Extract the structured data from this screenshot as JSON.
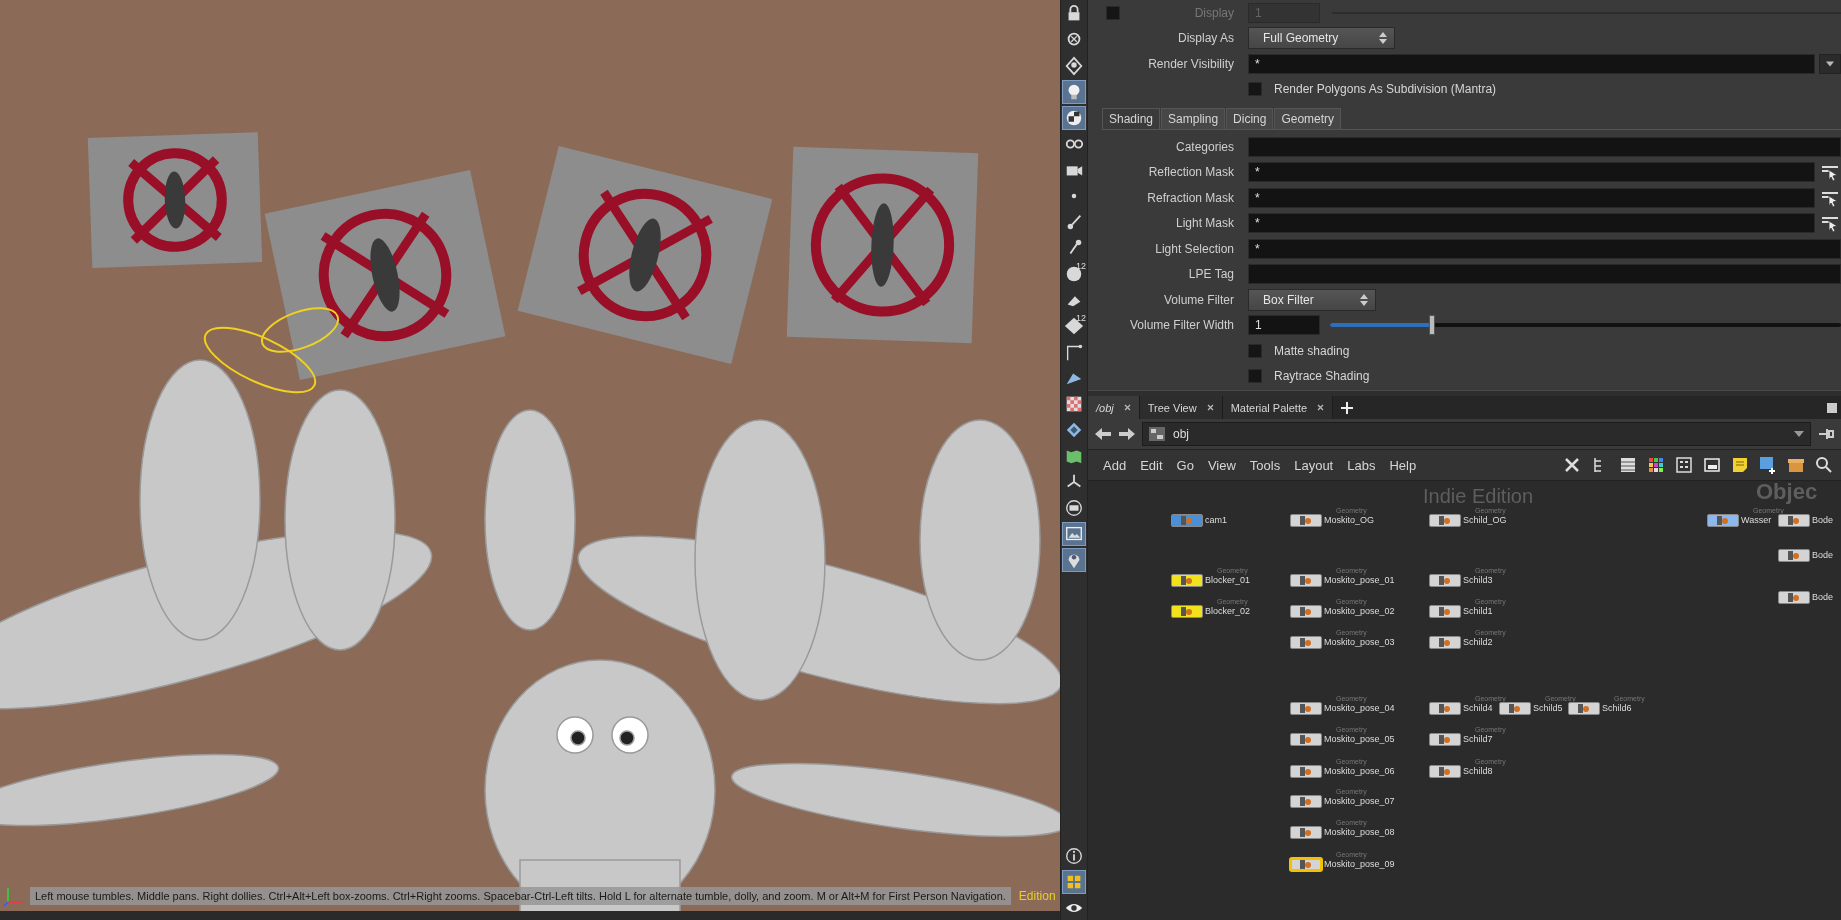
{
  "viewport": {
    "status_text": "Left mouse tumbles. Middle pans. Right dollies. Ctrl+Alt+Left box-zooms. Ctrl+Right zooms. Spacebar-Ctrl-Left tilts. Hold L for alternate tumble, dolly, and zoom. M or Alt+M for First Person Navigation.",
    "edition_text": "Edition"
  },
  "shelf_top": [
    {
      "kind": "lock",
      "selected": false
    },
    {
      "kind": "ghost",
      "selected": false
    },
    {
      "kind": "light_diamond",
      "selected": false
    },
    {
      "kind": "bulb",
      "selected": true
    },
    {
      "kind": "sphere",
      "selected": true
    },
    {
      "kind": "glasses",
      "selected": false
    },
    {
      "kind": "camera",
      "selected": false
    },
    {
      "kind": "dot",
      "selected": false
    },
    {
      "kind": "brush",
      "selected": false
    },
    {
      "kind": "pin",
      "selected": false
    },
    {
      "kind": "dot_number",
      "label": "12",
      "selected": false
    },
    {
      "kind": "paint",
      "selected": false
    },
    {
      "kind": "layers_number",
      "label": "12",
      "selected": false
    },
    {
      "kind": "corner",
      "selected": false
    },
    {
      "kind": "plane",
      "selected": false
    },
    {
      "kind": "checker",
      "selected": false
    },
    {
      "kind": "diamond",
      "selected": false
    },
    {
      "kind": "map",
      "selected": false
    },
    {
      "kind": "axes",
      "selected": false
    },
    {
      "kind": "frame",
      "selected": false
    },
    {
      "kind": "picture",
      "selected": true
    },
    {
      "kind": "location",
      "selected": true
    }
  ],
  "shelf_bottom": [
    {
      "kind": "info",
      "selected": false
    },
    {
      "kind": "grid",
      "selected": true
    },
    {
      "kind": "eye",
      "selected": false
    }
  ],
  "parameters": [
    {
      "kind": "toggle_field",
      "label": "Display",
      "value": "1",
      "checked": false,
      "disabled": true
    },
    {
      "kind": "dropdown",
      "label": "Display As",
      "value": "Full Geometry"
    },
    {
      "kind": "field",
      "label": "Render Visibility",
      "value": "*",
      "menu": true
    },
    {
      "kind": "checkbox",
      "label": "Render Polygons As Subdivision (Mantra)",
      "checked": false
    }
  ],
  "parameter_tabs": [
    {
      "label": "Shading",
      "selected": true
    },
    {
      "label": "Sampling",
      "selected": false
    },
    {
      "label": "Dicing",
      "selected": false
    },
    {
      "label": "Geometry",
      "selected": false
    }
  ],
  "shading_parameters": [
    {
      "kind": "field",
      "label": "Categories"
    },
    {
      "kind": "field",
      "label": "Reflection Mask",
      "value": "*",
      "picker": true
    },
    {
      "kind": "field",
      "label": "Refraction Mask",
      "value": "*",
      "picker": true
    },
    {
      "kind": "field",
      "label": "Light Mask",
      "value": "*",
      "picker": true
    },
    {
      "kind": "field",
      "label": "Light Selection",
      "value": "*"
    },
    {
      "kind": "field",
      "label": "LPE Tag"
    },
    {
      "kind": "dropdown",
      "label": "Volume Filter",
      "value": "Box Filter"
    },
    {
      "kind": "slider",
      "label": "Volume Filter Width",
      "value": "1",
      "level": 0.2
    },
    {
      "kind": "checkbox",
      "label": "Matte shading",
      "checked": false
    },
    {
      "kind": "checkbox",
      "label": "Raytrace Shading",
      "checked": false
    }
  ],
  "network": {
    "tabs": [
      {
        "label": "/obj",
        "selected": true
      },
      {
        "label": "Tree View",
        "selected": false
      },
      {
        "label": "Material Palette",
        "selected": false
      }
    ],
    "path": "obj",
    "menu": [
      "Add",
      "Edit",
      "Go",
      "View",
      "Tools",
      "Layout",
      "Labs",
      "Help"
    ],
    "watermark": "Indie Edition",
    "context_label": "Objec",
    "nodes": [
      {
        "name": "cam1",
        "color": "#4a8fd8",
        "selected": false
      },
      {
        "name": "Moskito_OG",
        "type": "Geometry",
        "color": "#d4d4d4",
        "selected": false
      },
      {
        "name": "Schild_OG",
        "type": "Geometry",
        "color": "#d4d4d4",
        "selected": false
      },
      {
        "name": "Wasser",
        "type": "Geometry",
        "color": "#8cb8ee",
        "selected": false
      },
      {
        "name": "Bode",
        "color": "#d4d4d4",
        "selected": false
      },
      {
        "name": "Bode",
        "color": "#d4d4d4",
        "selected": false
      },
      {
        "name": "Blocker_01",
        "type": "Geometry",
        "color": "#f2e21c",
        "selected": false
      },
      {
        "name": "Moskito_pose_01",
        "type": "Geometry",
        "color": "#d4d4d4",
        "selected": false
      },
      {
        "name": "Schild3",
        "type": "Geometry",
        "color": "#d4d4d4",
        "selected": false
      },
      {
        "name": "Bode",
        "color": "#d4d4d4",
        "selected": false
      },
      {
        "name": "Blocker_02",
        "type": "Geometry",
        "color": "#f2e21c",
        "selected": false
      },
      {
        "name": "Moskito_pose_02",
        "type": "Geometry",
        "color": "#d4d4d4",
        "selected": false
      },
      {
        "name": "Schild1",
        "type": "Geometry",
        "color": "#d4d4d4",
        "selected": false
      },
      {
        "name": "Moskito_pose_03",
        "type": "Geometry",
        "color": "#d4d4d4",
        "selected": false
      },
      {
        "name": "Schild2",
        "type": "Geometry",
        "color": "#d4d4d4",
        "selected": false
      },
      {
        "name": "Moskito_pose_04",
        "type": "Geometry",
        "color": "#d4d4d4",
        "selected": false
      },
      {
        "name": "Schild4",
        "type": "Geometry",
        "color": "#d4d4d4",
        "selected": false
      },
      {
        "name": "Schild5",
        "type": "Geometry",
        "color": "#d4d4d4",
        "selected": false
      },
      {
        "name": "Schild6",
        "type": "Geometry",
        "color": "#d4d4d4",
        "selected": false
      },
      {
        "name": "Moskito_pose_05",
        "type": "Geometry",
        "color": "#d4d4d4",
        "selected": false
      },
      {
        "name": "Schild7",
        "type": "Geometry",
        "color": "#d4d4d4",
        "selected": false
      },
      {
        "name": "Moskito_pose_06",
        "type": "Geometry",
        "color": "#d4d4d4",
        "selected": false
      },
      {
        "name": "Schild8",
        "type": "Geometry",
        "color": "#d4d4d4",
        "selected": false
      },
      {
        "name": "Moskito_pose_07",
        "type": "Geometry",
        "color": "#d4d4d4",
        "selected": false
      },
      {
        "name": "Moskito_pose_08",
        "type": "Geometry",
        "color": "#d4d4d4",
        "selected": false
      },
      {
        "name": "Moskito_pose_09",
        "type": "Geometry",
        "color": "#d4d4d4",
        "selected": true
      }
    ]
  }
}
